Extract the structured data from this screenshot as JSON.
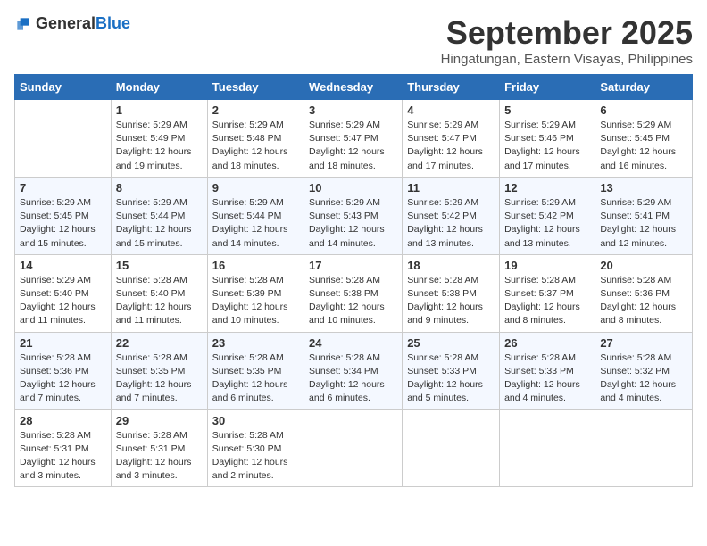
{
  "header": {
    "logo_general": "General",
    "logo_blue": "Blue",
    "month_title": "September 2025",
    "location": "Hingatungan, Eastern Visayas, Philippines"
  },
  "columns": [
    "Sunday",
    "Monday",
    "Tuesday",
    "Wednesday",
    "Thursday",
    "Friday",
    "Saturday"
  ],
  "weeks": [
    [
      null,
      {
        "day": "1",
        "sunrise": "5:29 AM",
        "sunset": "5:49 PM",
        "daylight": "12 hours and 19 minutes."
      },
      {
        "day": "2",
        "sunrise": "5:29 AM",
        "sunset": "5:48 PM",
        "daylight": "12 hours and 18 minutes."
      },
      {
        "day": "3",
        "sunrise": "5:29 AM",
        "sunset": "5:47 PM",
        "daylight": "12 hours and 18 minutes."
      },
      {
        "day": "4",
        "sunrise": "5:29 AM",
        "sunset": "5:47 PM",
        "daylight": "12 hours and 17 minutes."
      },
      {
        "day": "5",
        "sunrise": "5:29 AM",
        "sunset": "5:46 PM",
        "daylight": "12 hours and 17 minutes."
      },
      {
        "day": "6",
        "sunrise": "5:29 AM",
        "sunset": "5:45 PM",
        "daylight": "12 hours and 16 minutes."
      }
    ],
    [
      {
        "day": "7",
        "sunrise": "5:29 AM",
        "sunset": "5:45 PM",
        "daylight": "12 hours and 15 minutes."
      },
      {
        "day": "8",
        "sunrise": "5:29 AM",
        "sunset": "5:44 PM",
        "daylight": "12 hours and 15 minutes."
      },
      {
        "day": "9",
        "sunrise": "5:29 AM",
        "sunset": "5:44 PM",
        "daylight": "12 hours and 14 minutes."
      },
      {
        "day": "10",
        "sunrise": "5:29 AM",
        "sunset": "5:43 PM",
        "daylight": "12 hours and 14 minutes."
      },
      {
        "day": "11",
        "sunrise": "5:29 AM",
        "sunset": "5:42 PM",
        "daylight": "12 hours and 13 minutes."
      },
      {
        "day": "12",
        "sunrise": "5:29 AM",
        "sunset": "5:42 PM",
        "daylight": "12 hours and 13 minutes."
      },
      {
        "day": "13",
        "sunrise": "5:29 AM",
        "sunset": "5:41 PM",
        "daylight": "12 hours and 12 minutes."
      }
    ],
    [
      {
        "day": "14",
        "sunrise": "5:29 AM",
        "sunset": "5:40 PM",
        "daylight": "12 hours and 11 minutes."
      },
      {
        "day": "15",
        "sunrise": "5:28 AM",
        "sunset": "5:40 PM",
        "daylight": "12 hours and 11 minutes."
      },
      {
        "day": "16",
        "sunrise": "5:28 AM",
        "sunset": "5:39 PM",
        "daylight": "12 hours and 10 minutes."
      },
      {
        "day": "17",
        "sunrise": "5:28 AM",
        "sunset": "5:38 PM",
        "daylight": "12 hours and 10 minutes."
      },
      {
        "day": "18",
        "sunrise": "5:28 AM",
        "sunset": "5:38 PM",
        "daylight": "12 hours and 9 minutes."
      },
      {
        "day": "19",
        "sunrise": "5:28 AM",
        "sunset": "5:37 PM",
        "daylight": "12 hours and 8 minutes."
      },
      {
        "day": "20",
        "sunrise": "5:28 AM",
        "sunset": "5:36 PM",
        "daylight": "12 hours and 8 minutes."
      }
    ],
    [
      {
        "day": "21",
        "sunrise": "5:28 AM",
        "sunset": "5:36 PM",
        "daylight": "12 hours and 7 minutes."
      },
      {
        "day": "22",
        "sunrise": "5:28 AM",
        "sunset": "5:35 PM",
        "daylight": "12 hours and 7 minutes."
      },
      {
        "day": "23",
        "sunrise": "5:28 AM",
        "sunset": "5:35 PM",
        "daylight": "12 hours and 6 minutes."
      },
      {
        "day": "24",
        "sunrise": "5:28 AM",
        "sunset": "5:34 PM",
        "daylight": "12 hours and 6 minutes."
      },
      {
        "day": "25",
        "sunrise": "5:28 AM",
        "sunset": "5:33 PM",
        "daylight": "12 hours and 5 minutes."
      },
      {
        "day": "26",
        "sunrise": "5:28 AM",
        "sunset": "5:33 PM",
        "daylight": "12 hours and 4 minutes."
      },
      {
        "day": "27",
        "sunrise": "5:28 AM",
        "sunset": "5:32 PM",
        "daylight": "12 hours and 4 minutes."
      }
    ],
    [
      {
        "day": "28",
        "sunrise": "5:28 AM",
        "sunset": "5:31 PM",
        "daylight": "12 hours and 3 minutes."
      },
      {
        "day": "29",
        "sunrise": "5:28 AM",
        "sunset": "5:31 PM",
        "daylight": "12 hours and 3 minutes."
      },
      {
        "day": "30",
        "sunrise": "5:28 AM",
        "sunset": "5:30 PM",
        "daylight": "12 hours and 2 minutes."
      },
      null,
      null,
      null,
      null
    ]
  ],
  "labels": {
    "sunrise_label": "Sunrise:",
    "sunset_label": "Sunset:",
    "daylight_label": "Daylight:"
  }
}
